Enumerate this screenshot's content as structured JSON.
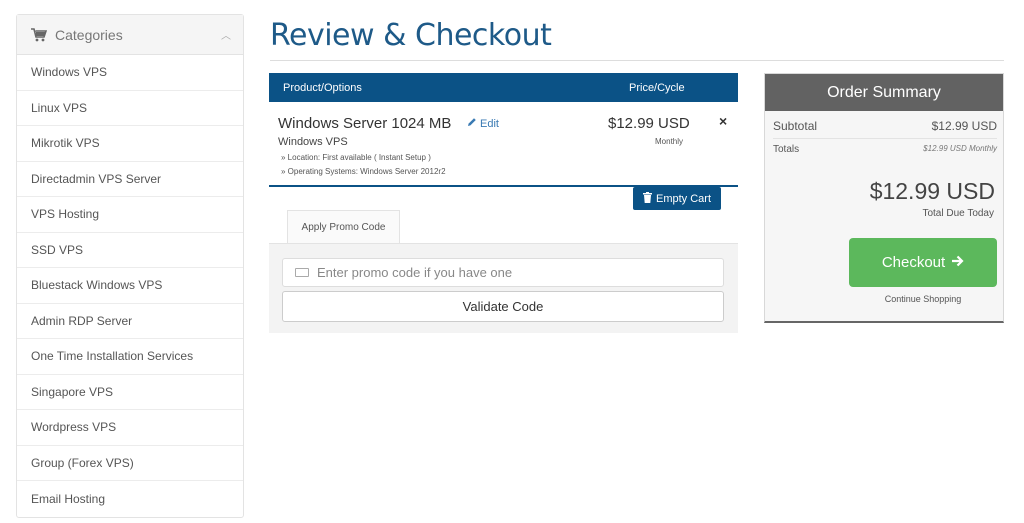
{
  "sidebar": {
    "title": "Categories",
    "items": [
      {
        "label": "Windows VPS"
      },
      {
        "label": "Linux VPS"
      },
      {
        "label": "Mikrotik VPS"
      },
      {
        "label": "Directadmin VPS Server"
      },
      {
        "label": "VPS Hosting"
      },
      {
        "label": "SSD VPS"
      },
      {
        "label": "Bluestack Windows VPS"
      },
      {
        "label": "Admin RDP Server"
      },
      {
        "label": "One Time Installation Services"
      },
      {
        "label": "Singapore VPS"
      },
      {
        "label": "Wordpress VPS"
      },
      {
        "label": "Group (Forex VPS)"
      },
      {
        "label": "Email Hosting"
      }
    ]
  },
  "page": {
    "title": "Review & Checkout"
  },
  "cart": {
    "headers": {
      "product": "Product/Options",
      "price": "Price/Cycle"
    },
    "item": {
      "name": "Windows Server 1024 MB",
      "edit_label": "Edit",
      "group": "Windows VPS",
      "options": [
        "» Location: First available ( Instant Setup )",
        "» Operating Systems: Windows Server 2012r2"
      ],
      "price": "$12.99 USD",
      "cycle": "Monthly",
      "remove_symbol": "×"
    },
    "empty_cart_label": "Empty Cart"
  },
  "promo": {
    "tab_label": "Apply Promo Code",
    "placeholder": "Enter promo code if you have one",
    "validate_label": "Validate Code"
  },
  "summary": {
    "title": "Order Summary",
    "subtotal_label": "Subtotal",
    "subtotal_value": "$12.99 USD",
    "totals_label": "Totals",
    "totals_value": "$12.99 USD Monthly",
    "total_due": "$12.99 USD",
    "total_due_label": "Total Due Today",
    "checkout_label": "Checkout",
    "continue_label": "Continue Shopping"
  },
  "colors": {
    "brand_blue": "#0b5286",
    "title_blue": "#1e5a88",
    "checkout_green": "#5cb85c",
    "summary_header": "#626262"
  }
}
